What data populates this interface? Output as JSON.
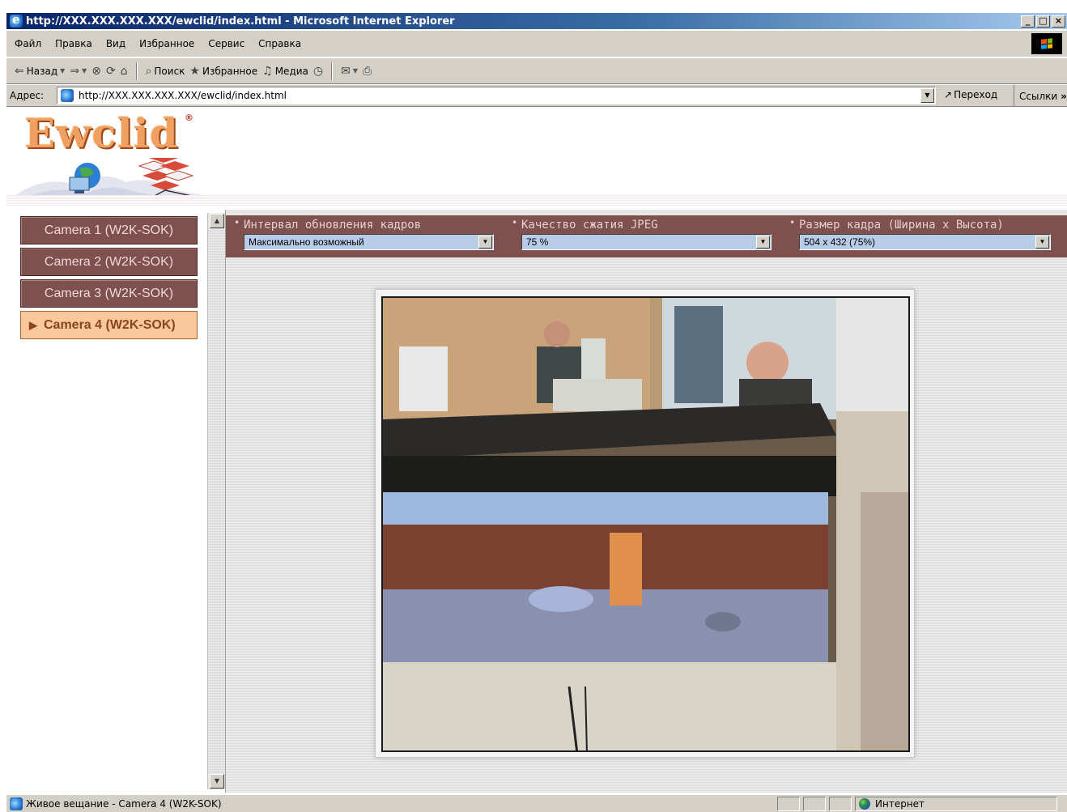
{
  "window": {
    "title": "http://XXX.XXX.XXX.XXX/ewclid/index.html - Microsoft Internet Explorer",
    "minimize": "_",
    "maximize": "□",
    "close": "×"
  },
  "menu": [
    "Файл",
    "Правка",
    "Вид",
    "Избранное",
    "Сервис",
    "Справка"
  ],
  "toolbar": {
    "back": "Назад",
    "search": "Поиск",
    "favorites": "Избранное",
    "media": "Медиа"
  },
  "address": {
    "label": "Адрес:",
    "url": "http://XXX.XXX.XXX.XXX/ewclid/index.html",
    "go": "Переход",
    "links": "Ссылки"
  },
  "brand": {
    "logo": "Ewclid",
    "reg": "®"
  },
  "cameras": [
    {
      "label": "Camera 1 (W2K-SOK)",
      "active": false
    },
    {
      "label": "Camera 2 (W2K-SOK)",
      "active": false
    },
    {
      "label": "Camera 3 (W2K-SOK)",
      "active": false
    },
    {
      "label": "Camera 4 (W2K-SOK)",
      "active": true
    }
  ],
  "controls": {
    "interval": {
      "label": "Интервал обновления кадров",
      "value": "Максимально возможный"
    },
    "quality": {
      "label": "Качество сжатия JPEG",
      "value": "75 %"
    },
    "size": {
      "label": "Размер кадра (Ширина x Высота)",
      "value": "504 x 432 (75%)"
    }
  },
  "status": {
    "text": "Живое вещание - Camera 4 (W2K-SOK)",
    "zone": "Интернет"
  },
  "colors": {
    "accent": "#7e504e",
    "active_camera": "#fbc79c",
    "titlebar": "#0a246a"
  }
}
